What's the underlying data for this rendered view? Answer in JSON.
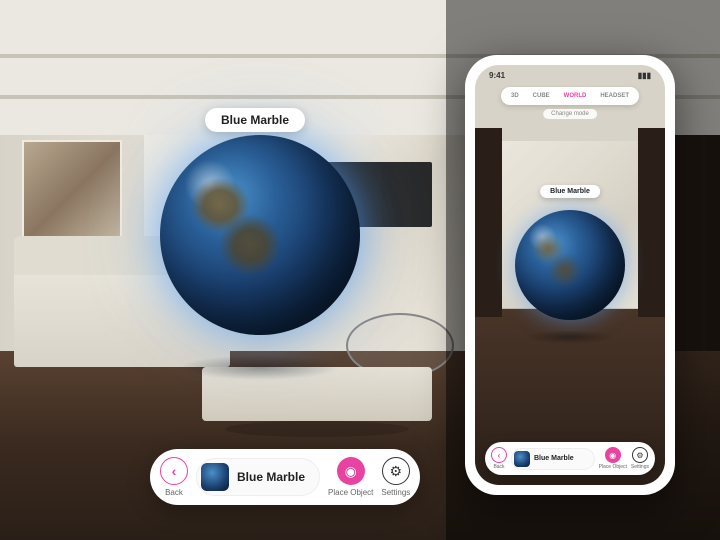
{
  "object": {
    "name": "Blue Marble"
  },
  "toolbar": {
    "back_label": "Back",
    "place_label": "Place Object",
    "settings_label": "Settings",
    "object_title": "Blue Marble"
  },
  "phone": {
    "status": {
      "time": "9:41"
    },
    "tabs": [
      "3D",
      "CUBE",
      "WORLD",
      "HEADSET"
    ],
    "active_tab": "WORLD",
    "subtitle": "Change mode",
    "label": "Blue Marble",
    "toolbar": {
      "back_label": "Back",
      "place_label": "Place Object",
      "settings_label": "Settings",
      "object_title": "Blue Marble"
    }
  },
  "colors": {
    "accent": "#e843a0"
  }
}
